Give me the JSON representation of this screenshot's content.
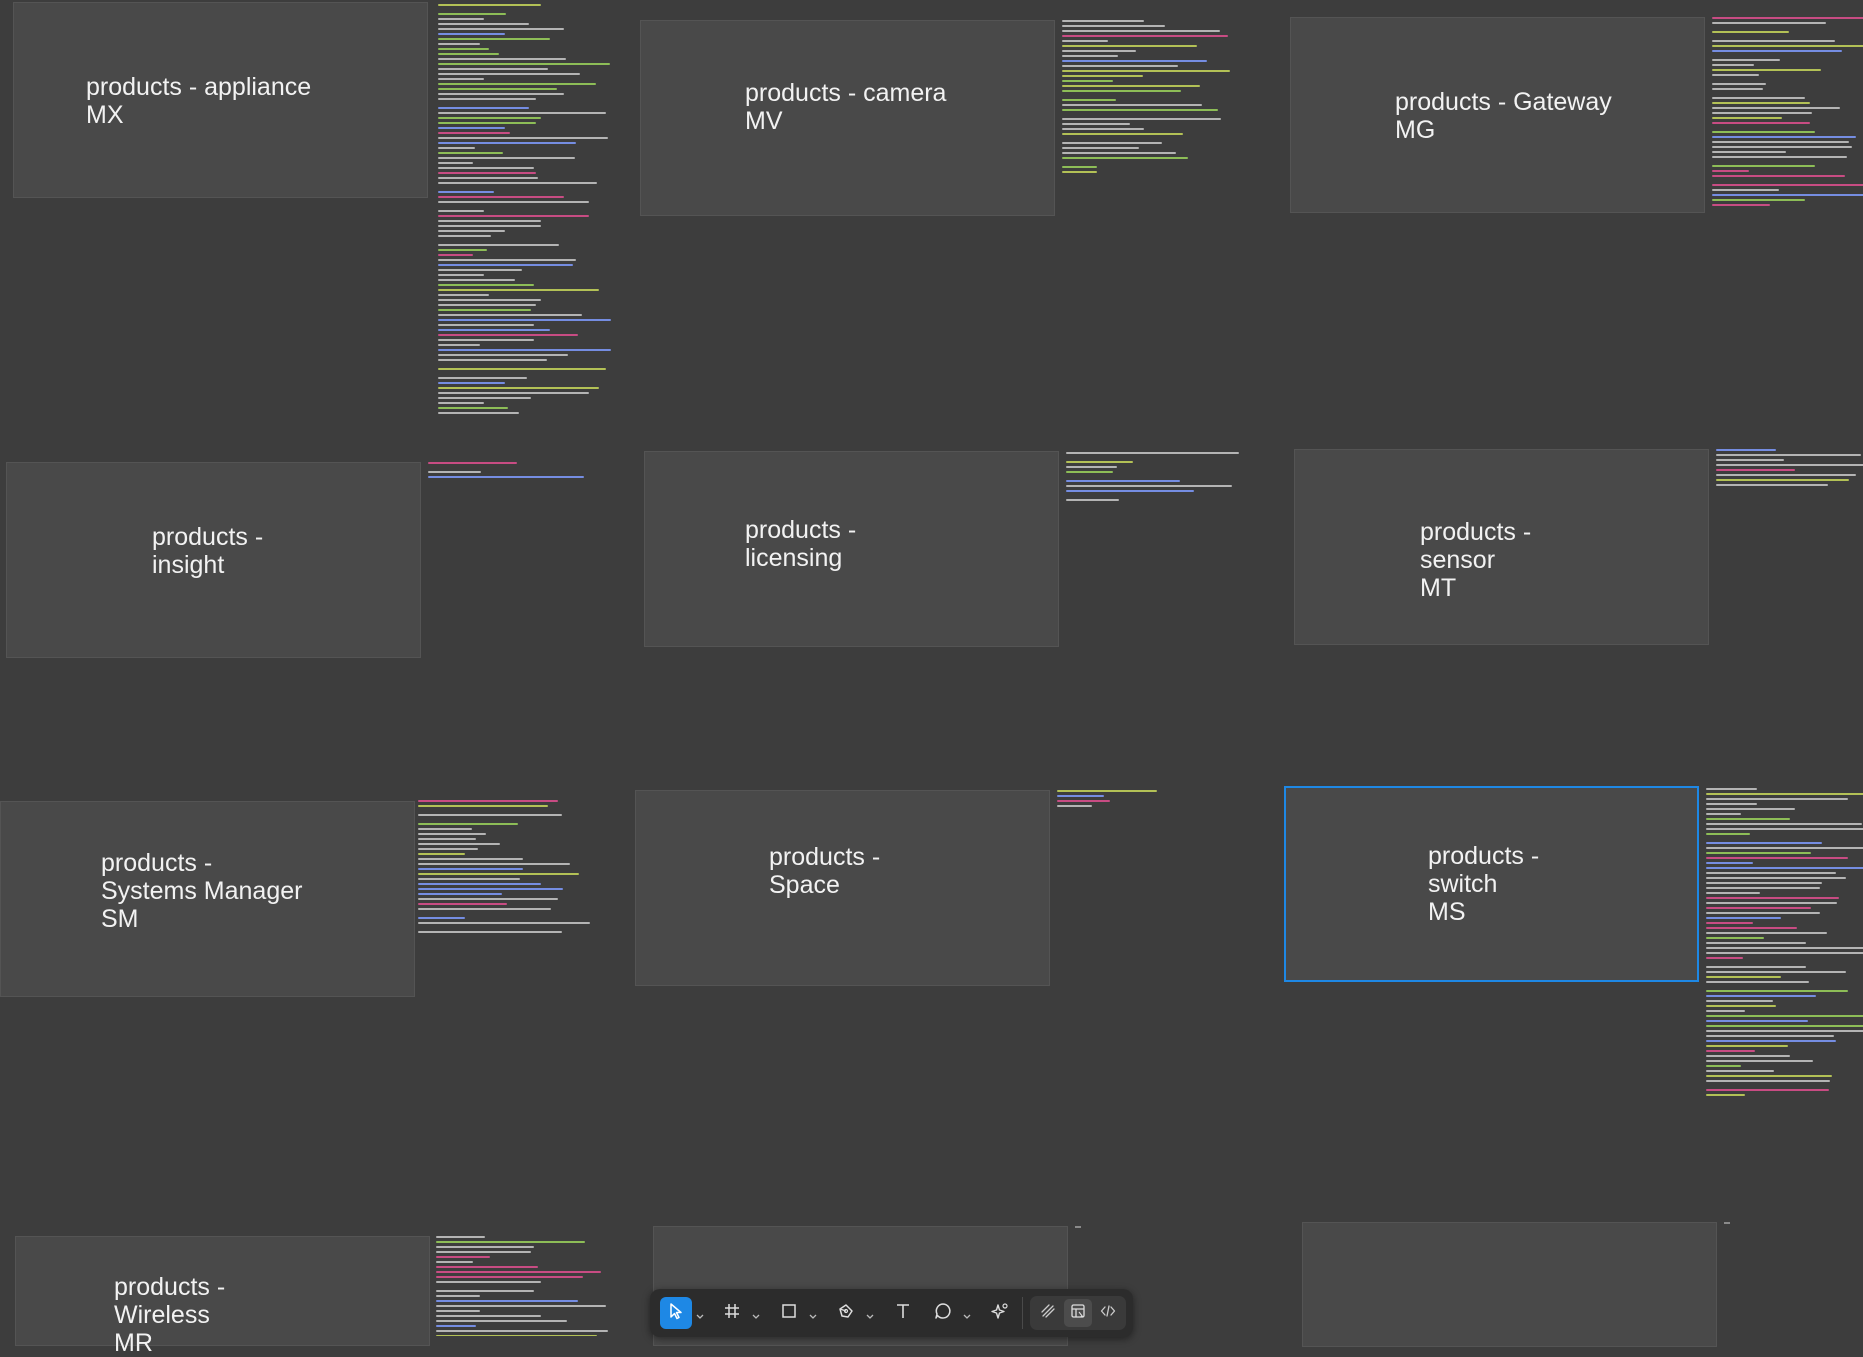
{
  "canvas": {
    "background": "#3d3d3d",
    "frame_color": "#494949",
    "selection_color": "#1e88e5",
    "frames": [
      {
        "id": "appliance",
        "title": "products - appliance\nMX"
      },
      {
        "id": "camera",
        "title": "products - camera\nMV"
      },
      {
        "id": "gateway",
        "title": "products - Gateway\nMG"
      },
      {
        "id": "insight",
        "title": "products -\ninsight"
      },
      {
        "id": "licensing",
        "title": "products -\nlicensing"
      },
      {
        "id": "sensor",
        "title": "products -\nsensor\nMT"
      },
      {
        "id": "systems-manager",
        "title": "products -\nSystems Manager\nSM"
      },
      {
        "id": "space",
        "title": "products -\nSpace"
      },
      {
        "id": "switch",
        "title": "products -\nswitch\nMS",
        "selected": true
      },
      {
        "id": "wireless",
        "title": "products -\nWireless\nMR"
      },
      {
        "id": "untitled-a",
        "title": ""
      },
      {
        "id": "untitled-b",
        "title": ""
      }
    ]
  },
  "toolbar": {
    "tools": [
      {
        "id": "move",
        "icon": "cursor-arrow-icon",
        "active": true,
        "has_menu": true
      },
      {
        "id": "frame",
        "icon": "frame-hash-icon",
        "has_menu": true
      },
      {
        "id": "shape",
        "icon": "rectangle-icon",
        "has_menu": true
      },
      {
        "id": "pen",
        "icon": "pen-icon",
        "has_menu": true
      },
      {
        "id": "text",
        "icon": "text-icon"
      },
      {
        "id": "comment",
        "icon": "comment-bubble-icon",
        "has_menu": true
      },
      {
        "id": "actions",
        "icon": "sparkle-actions-icon"
      }
    ],
    "modes": [
      {
        "id": "draw",
        "icon": "draw-mode-icon"
      },
      {
        "id": "design",
        "icon": "design-mode-icon",
        "active": true
      },
      {
        "id": "dev",
        "icon": "dev-mode-code-icon"
      }
    ]
  }
}
